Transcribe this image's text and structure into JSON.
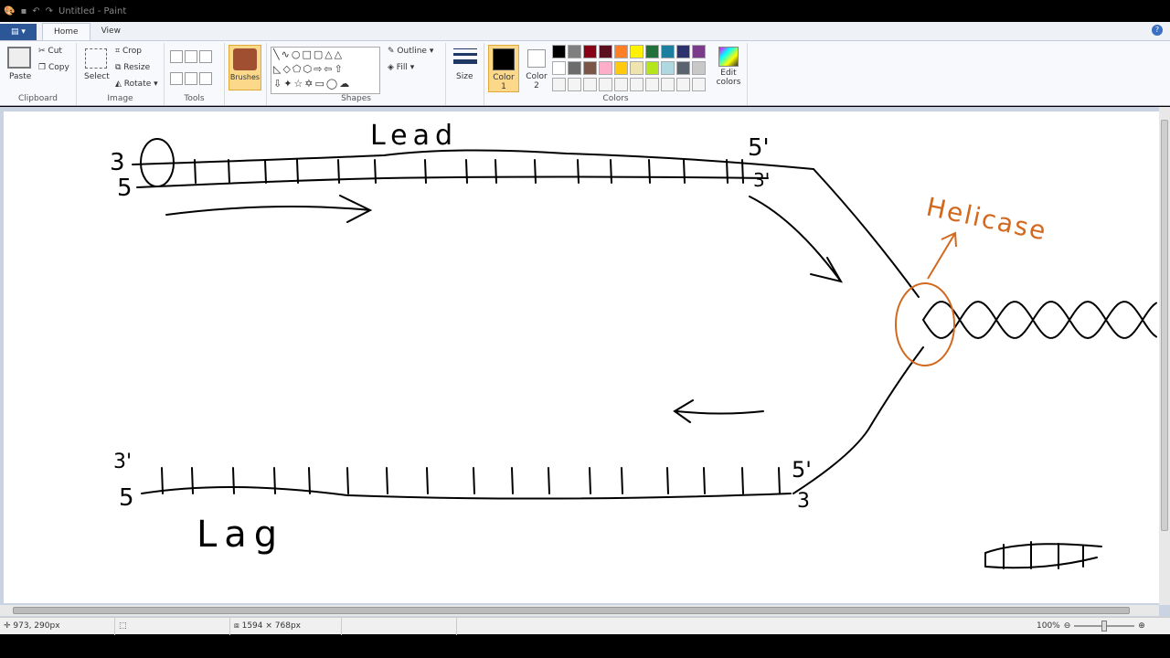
{
  "titlebar": {
    "title": "Untitled - Paint"
  },
  "tabs": {
    "file": "▤ ▾",
    "home": "Home",
    "view": "View",
    "help": "?"
  },
  "ribbon": {
    "clipboard": {
      "label": "Clipboard",
      "paste": "Paste",
      "cut": "Cut",
      "copy": "Copy"
    },
    "image": {
      "label": "Image",
      "select": "Select",
      "crop": "Crop",
      "resize": "Resize",
      "rotate": "Rotate"
    },
    "tools": {
      "label": "Tools"
    },
    "brushes": {
      "label": "Brushes"
    },
    "shapes": {
      "label": "Shapes",
      "outline": "Outline",
      "fill": "Fill"
    },
    "size": {
      "label": "Size"
    },
    "colors": {
      "label": "Colors",
      "color1": "Color 1",
      "color2": "Color 2",
      "edit": "Edit colors",
      "color1_value": "#000000",
      "color2_value": "#ffffff",
      "palette_row1": [
        "#000000",
        "#7f7f7f",
        "#880015",
        "#5c0f1e",
        "#ff7f27",
        "#fff200",
        "#22703a",
        "#1d7fa0",
        "#2e3170",
        "#7a3b8a"
      ],
      "palette_row2": [
        "#ffffff",
        "#6c6c6c",
        "#7a5548",
        "#ffaec9",
        "#ffc90e",
        "#efe4b0",
        "#b5e61d",
        "#b0d8e0",
        "#5a6470",
        "#c8c8c8"
      ]
    }
  },
  "drawing": {
    "lead": "Lead",
    "lag": "Lag",
    "helicase": "Helicase",
    "l3": "3",
    "l5": "5",
    "r5": "5'",
    "r3": "3'",
    "lag3": "3'",
    "lag5": "5",
    "lagr5": "5'",
    "lagr3": "3",
    "ink": "#000000",
    "helicase_color": "#d2691e"
  },
  "status": {
    "cursor": "973, 290px",
    "size": "1594 × 768px",
    "zoom": "100%"
  }
}
